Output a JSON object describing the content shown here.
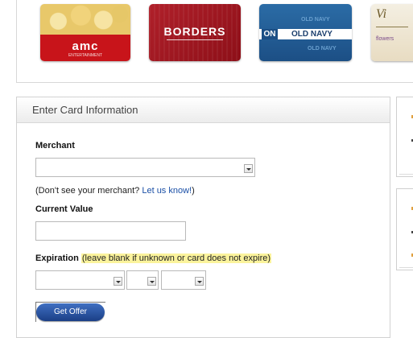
{
  "gift_cards": {
    "amc": {
      "logo": "amc",
      "sub": "ENTERTAINMENT"
    },
    "borders": {
      "logo": "BORDERS"
    },
    "oldnavy": {
      "mark": "ON",
      "logo": "OLD NAVY",
      "ghost_text": "OLD NAVY"
    },
    "floral": {
      "logo": "Vi",
      "text": "flowers"
    }
  },
  "form": {
    "title": "Enter Card Information",
    "merchant_label": "Merchant",
    "merchant_value": "",
    "hint_prefix": "(Don't see your merchant?",
    "hint_link": "Let us know!",
    "hint_suffix": ")",
    "current_value_label": "Current Value",
    "current_value": "",
    "expiration_label": "Expiration",
    "expiration_note": "(leave blank if unknown or card does not expire)",
    "exp_day": "",
    "exp_month": "",
    "exp_year": "",
    "submit_label": "Get Offer"
  },
  "colors": {
    "link": "#1a4fa6",
    "highlight": "#fbf39c",
    "button": "#1b3f86"
  }
}
